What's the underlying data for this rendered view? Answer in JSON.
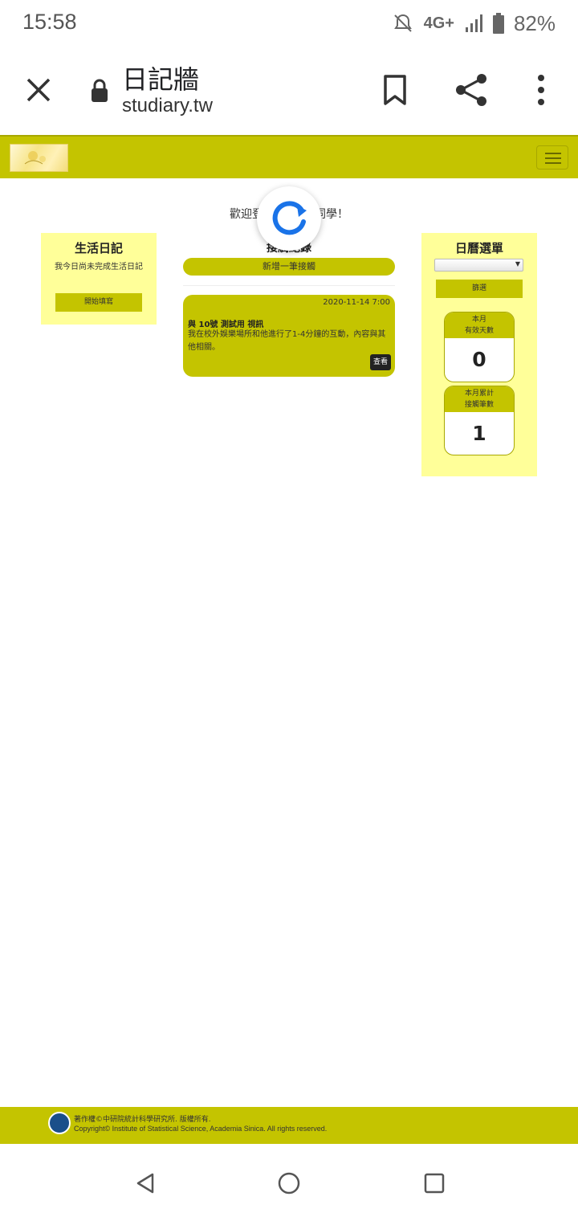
{
  "status_bar": {
    "time": "15:58",
    "network": "4G+",
    "battery": "82%"
  },
  "browser": {
    "page_title": "日記牆",
    "url": "studiary.tw"
  },
  "welcome": {
    "text_left": "歡迎登",
    "text_right": "同學！"
  },
  "left_panel": {
    "title": "生活日記",
    "desc": "我今日尚未完成生活日記",
    "button": "開始填寫"
  },
  "middle": {
    "title": "接觸紀錄",
    "add_button": "新增一筆接觸",
    "cards": [
      {
        "date": "2020-11-14 7:00",
        "title": "與 10號 測試用 視訊",
        "body": "我在校外娛樂場所和他進行了1-4分鐘的互動，內容與其他相關。",
        "view": "查看"
      }
    ]
  },
  "right_panel": {
    "title": "日曆選單",
    "filter_button": "篩選",
    "stats": [
      {
        "label_1": "本月",
        "label_2": "有效天數",
        "value": "0"
      },
      {
        "label_1": "本月累計",
        "label_2": "接觸筆數",
        "value": "1"
      }
    ]
  },
  "footer": {
    "line1": "著作權©中研院統計科學研究所. 版權所有.",
    "line2": "Copyright© Institute of Statistical Science, Academia Sinica. All rights reserved."
  },
  "colors": {
    "accent": "#c4c400",
    "panel": "#ffff99"
  }
}
